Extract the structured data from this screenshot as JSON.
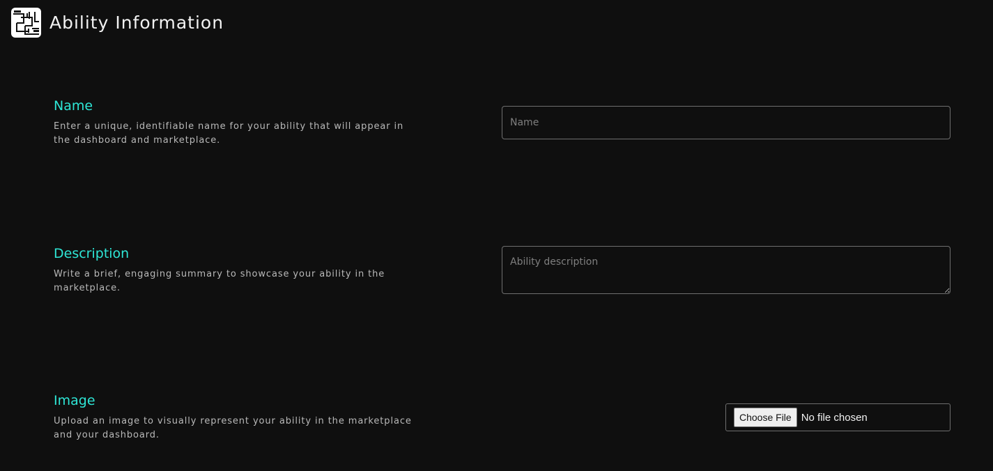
{
  "header": {
    "logo_icon": "circuit-logo-icon",
    "title": "Ability Information"
  },
  "fields": {
    "name": {
      "label": "Name",
      "help": "Enter a unique, identifiable name for your ability that will appear in the dashboard and marketplace.",
      "placeholder": "Name",
      "value": ""
    },
    "description": {
      "label": "Description",
      "help": "Write a brief, engaging summary to showcase your ability in the marketplace.",
      "placeholder": "Ability description",
      "value": ""
    },
    "image": {
      "label": "Image",
      "help": "Upload an image to visually represent your ability in the marketplace and your dashboard.",
      "button_label": "Choose File",
      "status": "No file chosen"
    }
  },
  "colors": {
    "background": "#0f0f0f",
    "accent": "#2ee6d6",
    "help_text": "#b9b9b9",
    "input_border": "#6f6f6f"
  }
}
